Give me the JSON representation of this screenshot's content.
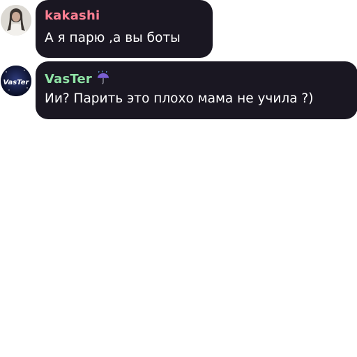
{
  "messages": [
    {
      "author": "kakashi",
      "text": "А я парю ,а вы боты",
      "name_color": "#ff7f93"
    },
    {
      "author": "VasTer",
      "author_badge_icon": "umbrella-rain-icon",
      "avatar_text": "VasTer",
      "text": "Ии? Парить это плохо мама не учила ?)",
      "name_color": "#8fe3a5"
    }
  ],
  "colors": {
    "bubble_background": "#1a1722",
    "message_text": "#ffffff"
  }
}
